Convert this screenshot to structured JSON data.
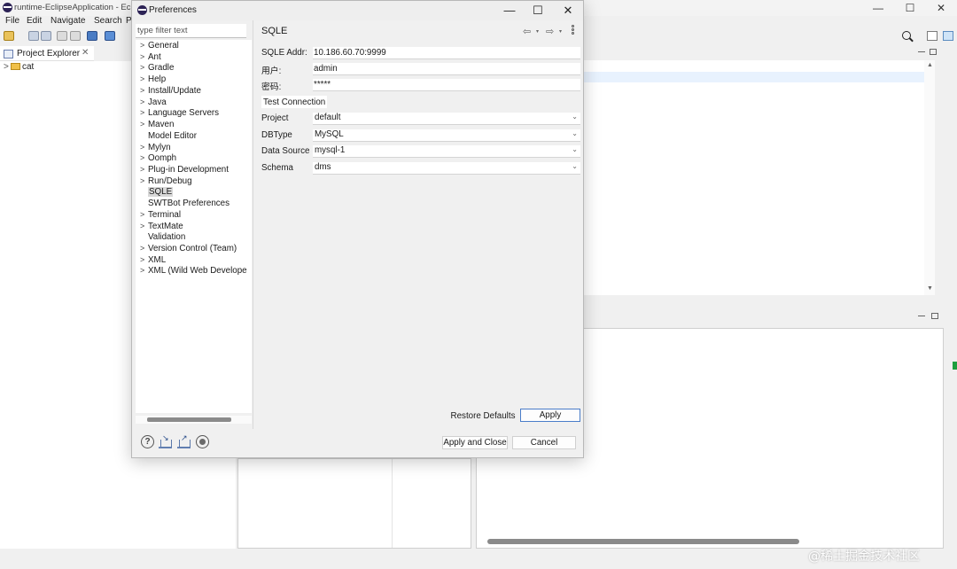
{
  "eclipse": {
    "window_title": "runtime-EclipseApplication - Eclip",
    "menu": [
      "File",
      "Edit",
      "Navigate",
      "Search",
      "P"
    ],
    "window_controls": {
      "minimize": "—",
      "maximize": "☐",
      "close": "✕"
    },
    "project_explorer": {
      "tab_label": "Project Explorer",
      "close_glyph": "✕",
      "tree": [
        {
          "label": "cat",
          "expander": ">"
        }
      ]
    }
  },
  "dialog": {
    "title": "Preferences",
    "window_controls": {
      "minimize": "—",
      "maximize": "☐",
      "close": "✕"
    },
    "filter_placeholder": "type filter text",
    "nav_items": [
      {
        "label": "General",
        "expandable": true
      },
      {
        "label": "Ant",
        "expandable": true
      },
      {
        "label": "Gradle",
        "expandable": true
      },
      {
        "label": "Help",
        "expandable": true
      },
      {
        "label": "Install/Update",
        "expandable": true
      },
      {
        "label": "Java",
        "expandable": true
      },
      {
        "label": "Language Servers",
        "expandable": true
      },
      {
        "label": "Maven",
        "expandable": true
      },
      {
        "label": "Model Editor",
        "expandable": false
      },
      {
        "label": "Mylyn",
        "expandable": true
      },
      {
        "label": "Oomph",
        "expandable": true
      },
      {
        "label": "Plug-in Development",
        "expandable": true
      },
      {
        "label": "Run/Debug",
        "expandable": true
      },
      {
        "label": "SQLE",
        "expandable": false,
        "selected": true
      },
      {
        "label": "SWTBot Preferences",
        "expandable": false
      },
      {
        "label": "Terminal",
        "expandable": true
      },
      {
        "label": "TextMate",
        "expandable": true
      },
      {
        "label": "Validation",
        "expandable": false
      },
      {
        "label": "Version Control (Team)",
        "expandable": true
      },
      {
        "label": "XML",
        "expandable": true
      },
      {
        "label": "XML (Wild Web Develope",
        "expandable": true
      }
    ],
    "expander_glyph": ">",
    "page": {
      "title": "SQLE",
      "back_glyph": "⇦",
      "forward_glyph": "⇨",
      "dropdown_glyph": "▾",
      "fields": {
        "addr": {
          "label": "SQLE Addr:",
          "value": "10.186.60.70:9999"
        },
        "user": {
          "label": "用户:",
          "value": "admin"
        },
        "password": {
          "label": "密码:",
          "value": "*****"
        }
      },
      "test_connection_label": "Test Connection",
      "combos": {
        "project": {
          "label": "Project",
          "value": "default"
        },
        "dbtype": {
          "label": "DBType",
          "value": "MySQL"
        },
        "datasource": {
          "label": "Data Source",
          "value": "mysql-1"
        },
        "schema": {
          "label": "Schema",
          "value": "dms"
        }
      },
      "combo_glyph": "⌄",
      "restore_defaults_label": "Restore Defaults",
      "apply_label": "Apply"
    },
    "footer": {
      "help_glyph": "?",
      "apply_and_close_label": "Apply and Close",
      "cancel_label": "Cancel"
    }
  },
  "watermark": "@稀土掘金技术社区"
}
